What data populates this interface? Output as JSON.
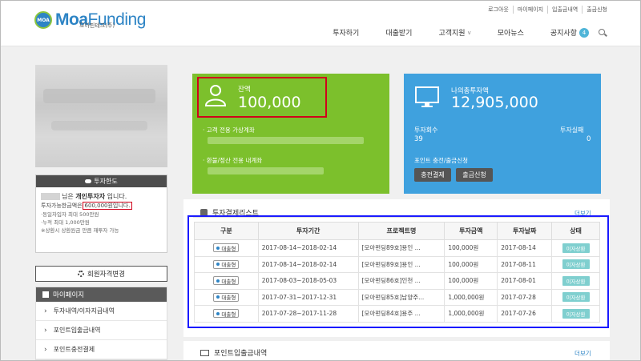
{
  "header": {
    "logo_mark": "MOA",
    "logo_moa": "Moa",
    "logo_funding": "Funding",
    "logo_sub": "모아핀테크(주)",
    "util_links": [
      "로그아웃",
      "마이페이지",
      "입출금내역",
      "출금신청"
    ],
    "nav": [
      {
        "label": "투자하기"
      },
      {
        "label": "대출받기"
      },
      {
        "label": "고객지원",
        "chevron": "v"
      },
      {
        "label": "모아뉴스"
      },
      {
        "label": "공지사항",
        "badge": "4"
      }
    ]
  },
  "sidebar": {
    "limit_title": "투자한도",
    "investor_suffix": "님은",
    "investor_type": "개인투자자",
    "investor_tail": "입니다.",
    "limit_prefix": "투자가능한금액은",
    "limit_amount": "600,000원입니다.",
    "note1": "·동일차입자 최대 500만원",
    "note2": "·누적 최대 1,000만원",
    "note3": "※상환시 상환원금 만큼 재투자 가능",
    "member_button": "회원자격변경",
    "menu_title": "마이페이지",
    "menu_items": [
      "투자내역/이자지급내역",
      "포인트입출금내역",
      "포인트충전결제"
    ]
  },
  "balance": {
    "label": "잔액",
    "value": "100,000",
    "account_label": "· 고객 전용 가상계좌",
    "refund_label": "· 환불/정산 전용 내계좌"
  },
  "total": {
    "label": "나의총투자액",
    "value": "12,905,000",
    "count_label": "투자회수",
    "count_value": "39",
    "fail_label": "투자실패",
    "fail_value": "0",
    "point_label": "포인트 충전/출금신청",
    "charge_button": "충전결제",
    "withdraw_button": "출금신청"
  },
  "investments": {
    "title": "투자결제리스트",
    "more": "더보기",
    "columns": [
      "구분",
      "투자기간",
      "프로젝트명",
      "투자금액",
      "투자날짜",
      "상태"
    ],
    "rows": [
      {
        "type": "대출형",
        "period": "2017-08-14~2018-02-14",
        "project": "[모아펀딩89호]용인 ...",
        "amount": "100,000원",
        "date": "2017-08-14",
        "status": "이자상환"
      },
      {
        "type": "대출형",
        "period": "2017-08-14~2018-02-14",
        "project": "[모아펀딩89호]용인 ...",
        "amount": "100,000원",
        "date": "2017-08-11",
        "status": "이자상환"
      },
      {
        "type": "대출형",
        "period": "2017-08-03~2018-05-03",
        "project": "[모아펀딩86호]인천 ...",
        "amount": "100,000원",
        "date": "2017-08-01",
        "status": "이자상환"
      },
      {
        "type": "대출형",
        "period": "2017-07-31~2017-12-31",
        "project": "[모아펀딩85호]남양주...",
        "amount": "1,000,000원",
        "date": "2017-07-28",
        "status": "이자상환"
      },
      {
        "type": "대출형",
        "period": "2017-07-28~2017-11-28",
        "project": "[모아펀딩84호]용주 ...",
        "amount": "1,000,000원",
        "date": "2017-07-26",
        "status": "이자상환"
      }
    ]
  },
  "points": {
    "title": "포인트입출금내역",
    "more": "더보기"
  },
  "colors": {
    "brand_blue": "#2d84c5",
    "balance_green": "#7cc02c",
    "total_blue": "#3fa1de",
    "highlight_red": "#d0021b",
    "highlight_blue": "#1a1aff",
    "status_teal": "#7fcfcf"
  },
  "icons": {
    "balance": "person-icon",
    "total": "monitor-icon",
    "limit": "cloud-icon",
    "member": "gear-icon",
    "search": "search-icon",
    "investments": "people-icon",
    "points": "credit-card-icon"
  }
}
